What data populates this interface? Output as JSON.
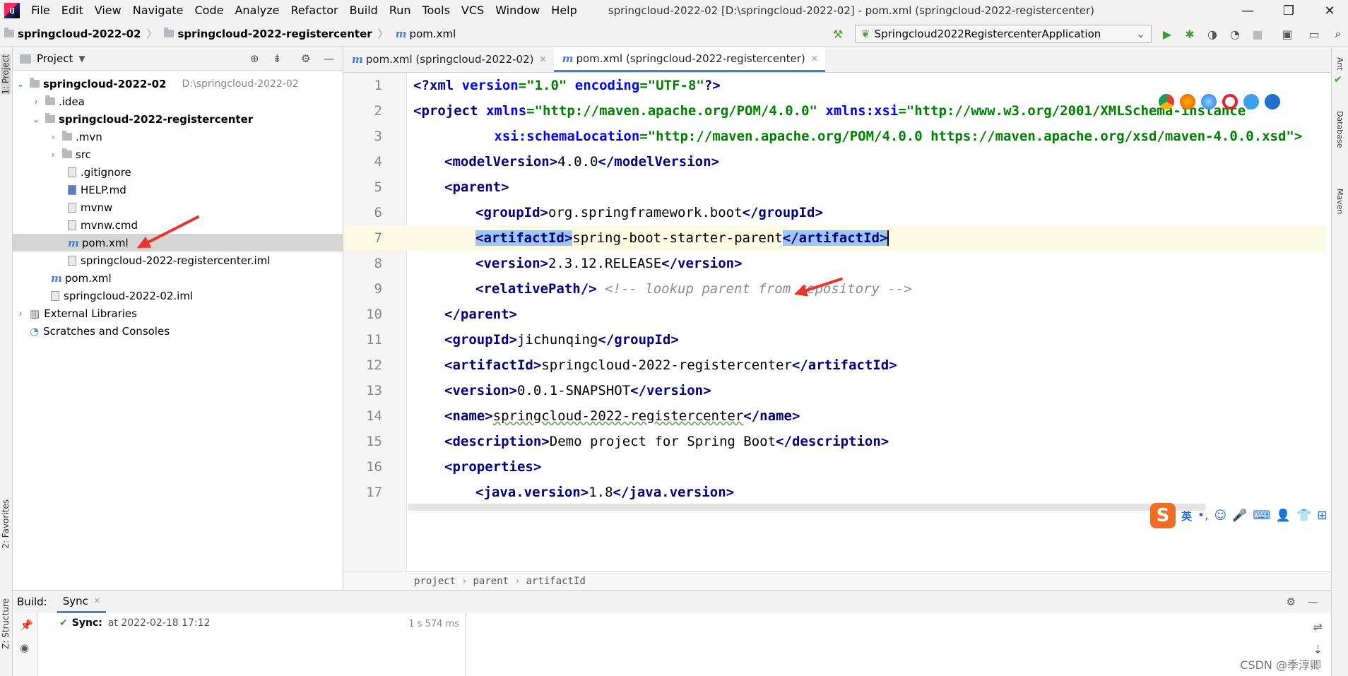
{
  "menubar": {
    "items": [
      "File",
      "Edit",
      "View",
      "Navigate",
      "Code",
      "Analyze",
      "Refactor",
      "Build",
      "Run",
      "Tools",
      "VCS",
      "Window",
      "Help"
    ],
    "window_title": "springcloud-2022-02 [D:\\springcloud-2022-02] - pom.xml (springcloud-2022-registercenter)"
  },
  "navbar": {
    "crumbs": [
      "springcloud-2022-02",
      "springcloud-2022-registercenter",
      "pom.xml"
    ],
    "run_config": "Springcloud2022RegistercenterApplication"
  },
  "left_stripe": {
    "project": "1: Project",
    "favorites": "2: Favorites",
    "structure": "Z: Structure"
  },
  "right_stripe": {
    "ant": "Ant",
    "database": "Database",
    "maven": "Maven"
  },
  "project": {
    "title": "Project",
    "tree": [
      {
        "label": "springcloud-2022-02",
        "path": "D:\\springcloud-2022-02"
      },
      {
        "label": ".idea"
      },
      {
        "label": "springcloud-2022-registercenter"
      },
      {
        "label": ".mvn"
      },
      {
        "label": "src"
      },
      {
        "label": ".gitignore"
      },
      {
        "label": "HELP.md"
      },
      {
        "label": "mvnw"
      },
      {
        "label": "mvnw.cmd"
      },
      {
        "label": "pom.xml"
      },
      {
        "label": "springcloud-2022-registercenter.iml"
      },
      {
        "label": "pom.xml"
      },
      {
        "label": "springcloud-2022-02.iml"
      },
      {
        "label": "External Libraries"
      },
      {
        "label": "Scratches and Consoles"
      }
    ]
  },
  "editor": {
    "tabs": [
      "pom.xml (springcloud-2022-02)",
      "pom.xml (springcloud-2022-registercenter)"
    ],
    "line_numbers": [
      "1",
      "2",
      "3",
      "4",
      "5",
      "6",
      "7",
      "8",
      "9",
      "10",
      "11",
      "12",
      "13",
      "14",
      "15",
      "16",
      "17"
    ],
    "code": {
      "l1_decl": "<?xml",
      "l1_a1": " version",
      "l1_v1": "=\"1.0\"",
      "l1_a2": " encoding",
      "l1_v2": "=\"UTF-8\"",
      "l1_end": "?>",
      "l2_open": "<project",
      "l2_a1": " xmlns",
      "l2_v1": "=\"http://maven.apache.org/POM/4.0.0\"",
      "l2_a2": " xmlns:xsi",
      "l2_v2": "=\"http://www.w3.org/2001/XMLSchema-instance\"",
      "l3_a": "xsi:schemaLocation",
      "l3_v": "=\"http://maven.apache.org/POM/4.0.0 https://maven.apache.org/xsd/maven-4.0.0.xsd\">",
      "l4_tag": "modelVersion",
      "l4_val": "4.0.0",
      "l5_tag": "parent",
      "l6_tag": "groupId",
      "l6_val": "org.springframework.boot",
      "l7_tag": "artifactId",
      "l7_val": "spring-boot-starter-parent",
      "l8_tag": "version",
      "l8_val": "2.3.12.RELEASE",
      "l9_tag": "relativePath",
      "l9_cmt": "<!-- lookup parent from repository -->",
      "l10_tag": "parent",
      "l11_tag": "groupId",
      "l11_val": "jichunqing",
      "l12_tag": "artifactId",
      "l12_val": "springcloud-2022-registercenter",
      "l13_tag": "version",
      "l13_val": "0.0.1-SNAPSHOT",
      "l14_tag": "name",
      "l14_val": "springcloud-2022-registercenter",
      "l15_tag": "description",
      "l15_val": "Demo project for Spring Boot",
      "l16_tag": "properties",
      "l17_tag": "java.version",
      "l17_val": "1.8"
    },
    "breadcrumbs": [
      "project",
      "parent",
      "artifactId"
    ]
  },
  "ime": {
    "lang": "英"
  },
  "build": {
    "label": "Build:",
    "tab": "Sync",
    "sync_label": "Sync:",
    "sync_time": "at 2022-02-18 17:12",
    "duration": "1 s 574 ms"
  },
  "watermark": "CSDN @季淳卿",
  "colors": {
    "accent": "#4083c9",
    "tag": "#000080",
    "attr": "#0000ff",
    "value": "#008000",
    "selection": "#9fc6f0",
    "arrow": "#e8342a"
  }
}
